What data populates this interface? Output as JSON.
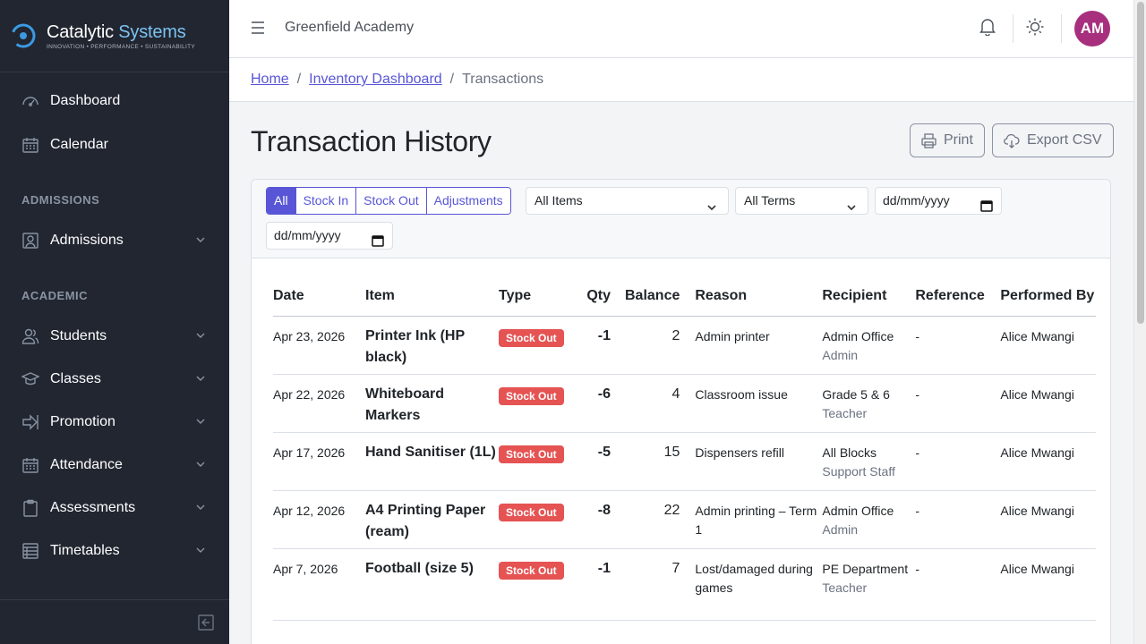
{
  "brand": {
    "name": "Catalytic",
    "name_accent": "Systems",
    "tagline": "INNOVATION • PERFORMANCE • SUSTAINABILITY"
  },
  "sidebar": {
    "items": [
      {
        "label": "Dashboard",
        "icon": "speedometer-icon"
      },
      {
        "label": "Calendar",
        "icon": "calendar-icon"
      },
      {
        "label": "Admissions",
        "icon": "contact-icon"
      },
      {
        "label": "Students",
        "icon": "people-icon"
      },
      {
        "label": "Classes",
        "icon": "education-icon"
      },
      {
        "label": "Promotion",
        "icon": "arrow-right-icon"
      },
      {
        "label": "Attendance",
        "icon": "calendar-check-icon"
      },
      {
        "label": "Assessments",
        "icon": "clipboard-icon"
      },
      {
        "label": "Timetables",
        "icon": "grid-icon"
      }
    ],
    "sections": {
      "admissions": "ADMISSIONS",
      "academic": "ACADEMIC"
    }
  },
  "header": {
    "school": "Greenfield Academy",
    "avatar_initials": "AM"
  },
  "breadcrumb": {
    "home": "Home",
    "dashboard": "Inventory Dashboard",
    "current": "Transactions",
    "separator": "/"
  },
  "page": {
    "title": "Transaction History",
    "print_label": "Print",
    "export_label": "Export CSV"
  },
  "filters": {
    "segments": [
      "All",
      "Stock In",
      "Stock Out",
      "Adjustments"
    ],
    "items_select": "All Items",
    "terms_select": "All Terms",
    "date_from": "dd/mm/yyyy",
    "date_to": "dd/mm/yyyy"
  },
  "table": {
    "headers": {
      "date": "Date",
      "item": "Item",
      "type": "Type",
      "qty": "Qty",
      "balance": "Balance",
      "reason": "Reason",
      "recipient": "Recipient",
      "reference": "Reference",
      "performed_by": "Performed By"
    },
    "rows": [
      {
        "date": "Apr 23, 2026",
        "item": "Printer Ink (HP black)",
        "type": "Stock Out",
        "qty": "-1",
        "balance": "2",
        "reason": "Admin printer",
        "recipient": "Admin Office",
        "recipient_role": "Admin",
        "reference": "-",
        "performed_by": "Alice Mwangi"
      },
      {
        "date": "Apr 22, 2026",
        "item": "Whiteboard Markers",
        "type": "Stock Out",
        "qty": "-6",
        "balance": "4",
        "reason": "Classroom issue",
        "recipient": "Grade 5 & 6",
        "recipient_role": "Teacher",
        "reference": "-",
        "performed_by": "Alice Mwangi"
      },
      {
        "date": "Apr 17, 2026",
        "item": "Hand Sanitiser (1L)",
        "type": "Stock Out",
        "qty": "-5",
        "balance": "15",
        "reason": "Dispensers refill",
        "recipient": "All Blocks",
        "recipient_role": "Support Staff",
        "reference": "-",
        "performed_by": "Alice Mwangi"
      },
      {
        "date": "Apr 12, 2026",
        "item": "A4 Printing Paper (ream)",
        "type": "Stock Out",
        "qty": "-8",
        "balance": "22",
        "reason": "Admin printing – Term 1",
        "recipient": "Admin Office",
        "recipient_role": "Admin",
        "reference": "-",
        "performed_by": "Alice Mwangi"
      },
      {
        "date": "Apr 7, 2026",
        "item": "Football (size 5)",
        "type": "Stock Out",
        "qty": "-1",
        "balance": "7",
        "reason": "Lost/damaged during games",
        "recipient": "PE Department",
        "recipient_role": "Teacher",
        "reference": "-",
        "performed_by": "Alice Mwangi"
      }
    ]
  },
  "colors": {
    "sidebar_bg": "#212631",
    "primary": "#5856d6",
    "danger": "#e55353",
    "avatar": "#a72f7e"
  }
}
